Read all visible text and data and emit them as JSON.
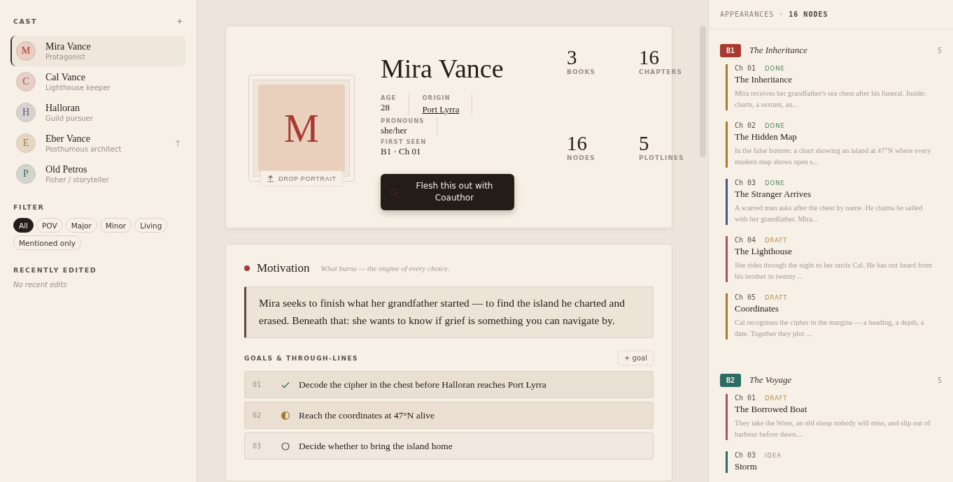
{
  "cast": {
    "title": "CAST",
    "add": "+",
    "members": [
      {
        "name": "Mira Vance",
        "role": "Protagonist",
        "initial": "M",
        "color": "#a83a32",
        "selected": true
      },
      {
        "name": "Cal Vance",
        "role": "Lighthouse keeper",
        "initial": "C",
        "color": "#a0484e",
        "selected": false
      },
      {
        "name": "Halloran",
        "role": "Guild pursuer",
        "initial": "H",
        "color": "#4a5a80",
        "selected": false
      },
      {
        "name": "Eber Vance",
        "role": "Posthumous architect",
        "initial": "E",
        "color": "#a07a3e",
        "selected": false,
        "marker": "†"
      },
      {
        "name": "Old Petros",
        "role": "Fisher / storyteller",
        "initial": "P",
        "color": "#2e6b63",
        "selected": false
      }
    ]
  },
  "filter": {
    "title": "FILTER",
    "chips": [
      {
        "label": "All",
        "selected": true
      },
      {
        "label": "POV",
        "selected": false
      },
      {
        "label": "Major",
        "selected": false
      },
      {
        "label": "Minor",
        "selected": false
      },
      {
        "label": "Living",
        "selected": false
      },
      {
        "label": "Mentioned only",
        "selected": false
      }
    ]
  },
  "recent": {
    "title": "RECENTLY EDITED",
    "empty": "No recent edits"
  },
  "character": {
    "initial": "M",
    "drop_label": "DROP PORTRAIT",
    "name": "Mira Vance",
    "facts": [
      {
        "label": "AGE",
        "value": "28",
        "kind": "text"
      },
      {
        "label": "ORIGIN",
        "value": "Port Lyrra",
        "kind": "link"
      },
      {
        "label": "PRONOUNS",
        "value": "she/her",
        "kind": "text"
      },
      {
        "label": "FIRST SEEN",
        "value": "B1 · Ch 01",
        "kind": "plain"
      }
    ],
    "action": "Flesh this out with Coauthor",
    "stats": [
      {
        "value": "3",
        "label": "BOOKS"
      },
      {
        "value": "16",
        "label": "CHAPTERS"
      },
      {
        "value": "16",
        "label": "NODES"
      },
      {
        "value": "5",
        "label": "PLOTLINES"
      }
    ]
  },
  "motivation": {
    "title": "Motivation",
    "subtitle": "What burns — the engine of every choice.",
    "text": "Mira seeks to finish what her grandfather started — to find the island he charted and erased. Beneath that: she wants to know if grief is something you can navigate by.",
    "goals_title": "GOALS & THROUGH-LINES",
    "add_goal": "+ goal",
    "goals": [
      {
        "number": "01",
        "text": "Decode the cipher in the chest before Halloran reaches Port Lyrra",
        "kind": "done"
      },
      {
        "number": "02",
        "text": "Reach the coordinates at 47°N alive",
        "kind": "partial"
      },
      {
        "number": "03",
        "text": "Decide whether to bring the island home",
        "kind": "open"
      }
    ]
  },
  "appearances": {
    "title": "APPEARANCES · **16 NODES**",
    "books": [
      {
        "badge": "B1",
        "title": "The Inheritance",
        "count": "5",
        "color": "#a83a32",
        "chapters": [
          {
            "number": "Ch 01",
            "status": "DONE",
            "kind": "done",
            "color": "#a87a2e",
            "title": "The Inheritance",
            "summary": "Mira receives her grandfather's sea chest after his funeral. Inside: charts, a sextant, an..."
          },
          {
            "number": "Ch 02",
            "status": "DONE",
            "kind": "done",
            "color": "#a87a2e",
            "title": "The Hidden Map",
            "summary": "In the false bottom: a chart showing an island at 47°N where every modern map shows open s..."
          },
          {
            "number": "Ch 03",
            "status": "DONE",
            "kind": "done",
            "color": "#45577e",
            "title": "The Stranger Arrives",
            "summary": "A scarred man asks after the chest by name. He claims he sailed with her grandfather. Mira..."
          },
          {
            "number": "Ch 04",
            "status": "DRAFT",
            "kind": "draft",
            "color": "#a85462",
            "title": "The Lighthouse",
            "summary": "She rides through the night to her uncle Cal. He has not heard from his brother in twenty ..."
          },
          {
            "number": "Ch 05",
            "status": "DRAFT",
            "kind": "draft",
            "color": "#a87a2e",
            "title": "Coordinates",
            "summary": "Cal recognises the cipher in the margins — a heading, a depth, a date. Together they plot ..."
          }
        ]
      },
      {
        "badge": "B2",
        "title": "The Voyage",
        "count": "5",
        "color": "#2e6b63",
        "chapters": [
          {
            "number": "Ch 01",
            "status": "DRAFT",
            "kind": "draft",
            "color": "#a85462",
            "title": "The Borrowed Boat",
            "summary": "They take the Wren, an old sloop nobody will miss, and slip out of harbour before dawn...."
          },
          {
            "number": "Ch 03",
            "status": "IDEA",
            "kind": "idea",
            "color": "#2e6b63",
            "title": "Storm"
          }
        ]
      }
    ]
  }
}
